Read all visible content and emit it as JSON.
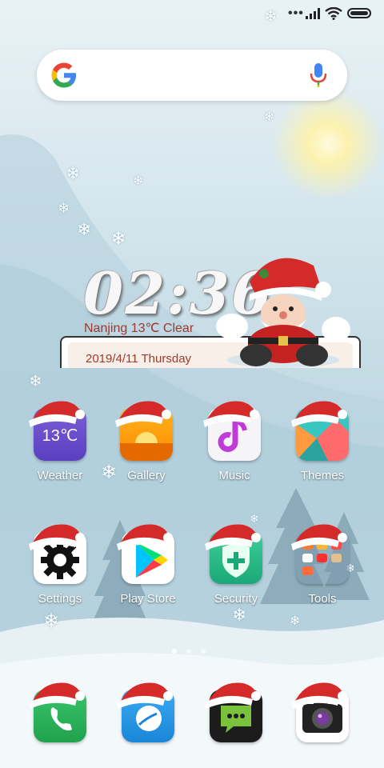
{
  "statusbar": {
    "icons": [
      "snowflake-icon",
      "more-dots-icon",
      "signal-icon",
      "wifi-icon",
      "battery-icon"
    ],
    "dots": "•••"
  },
  "search": {
    "logo": "google-g-logo",
    "mic": "mic-icon"
  },
  "clock_widget": {
    "time": "02:36",
    "weather": "Nanjing 13℃ Clear",
    "date": "2019/4/11 Thursday"
  },
  "apps": [
    {
      "label": "Weather",
      "icon": "weather-icon",
      "icon_text": "13℃"
    },
    {
      "label": "Gallery",
      "icon": "gallery-icon"
    },
    {
      "label": "Music",
      "icon": "music-icon"
    },
    {
      "label": "Themes",
      "icon": "themes-icon"
    },
    {
      "label": "Settings",
      "icon": "settings-icon"
    },
    {
      "label": "Play Store",
      "icon": "play-store-icon"
    },
    {
      "label": "Security",
      "icon": "security-icon"
    },
    {
      "label": "Tools",
      "icon": "tools-folder-icon"
    }
  ],
  "pager": {
    "pages": 3,
    "active": 1
  },
  "dock": [
    {
      "icon": "phone-icon"
    },
    {
      "icon": "messages-icon"
    },
    {
      "icon": "chat-icon"
    },
    {
      "icon": "camera-icon"
    }
  ],
  "colors": {
    "weather_text": "#a0392c",
    "label_text": "#ffffff",
    "hat_red": "#d42a2a"
  }
}
